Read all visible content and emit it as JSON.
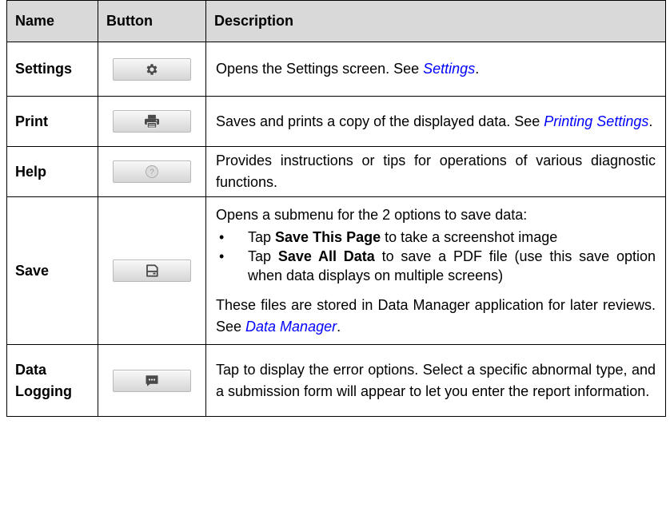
{
  "table": {
    "headers": [
      "Name",
      "Button",
      "Description"
    ],
    "rows": {
      "settings": {
        "name": "Settings",
        "icon": "gear-icon",
        "desc_text": "Opens the Settings screen. See ",
        "desc_link": "Settings",
        "desc_end": "."
      },
      "print": {
        "name": "Print",
        "icon": "printer-icon",
        "desc_text": "Saves and prints a copy of the displayed data. See ",
        "desc_link": "Printing Settings",
        "desc_end": "."
      },
      "help": {
        "name": "Help",
        "icon": "help-icon",
        "desc_text": "Provides instructions or tips for operations of various diagnostic functions."
      },
      "save": {
        "name": "Save",
        "icon": "save-icon",
        "desc_intro": "Opens a submenu for the 2 options to save data:",
        "options": [
          {
            "pre": "Tap ",
            "bold": "Save This Page",
            "post": " to take a screenshot image"
          },
          {
            "pre": "Tap ",
            "bold": "Save All Data",
            "post": " to save a PDF file (use this save option when data displays on multiple screens)"
          }
        ],
        "desc_after": "These files are stored in Data Manager application for later reviews. See ",
        "desc_link": "Data Manager",
        "desc_end": "."
      },
      "data_logging": {
        "name_line1": "Data",
        "name_line2": "Logging",
        "icon": "message-icon",
        "desc_text": "Tap to display the error options. Select a specific abnormal type, and a submission form will appear to let you enter the report information."
      }
    }
  }
}
